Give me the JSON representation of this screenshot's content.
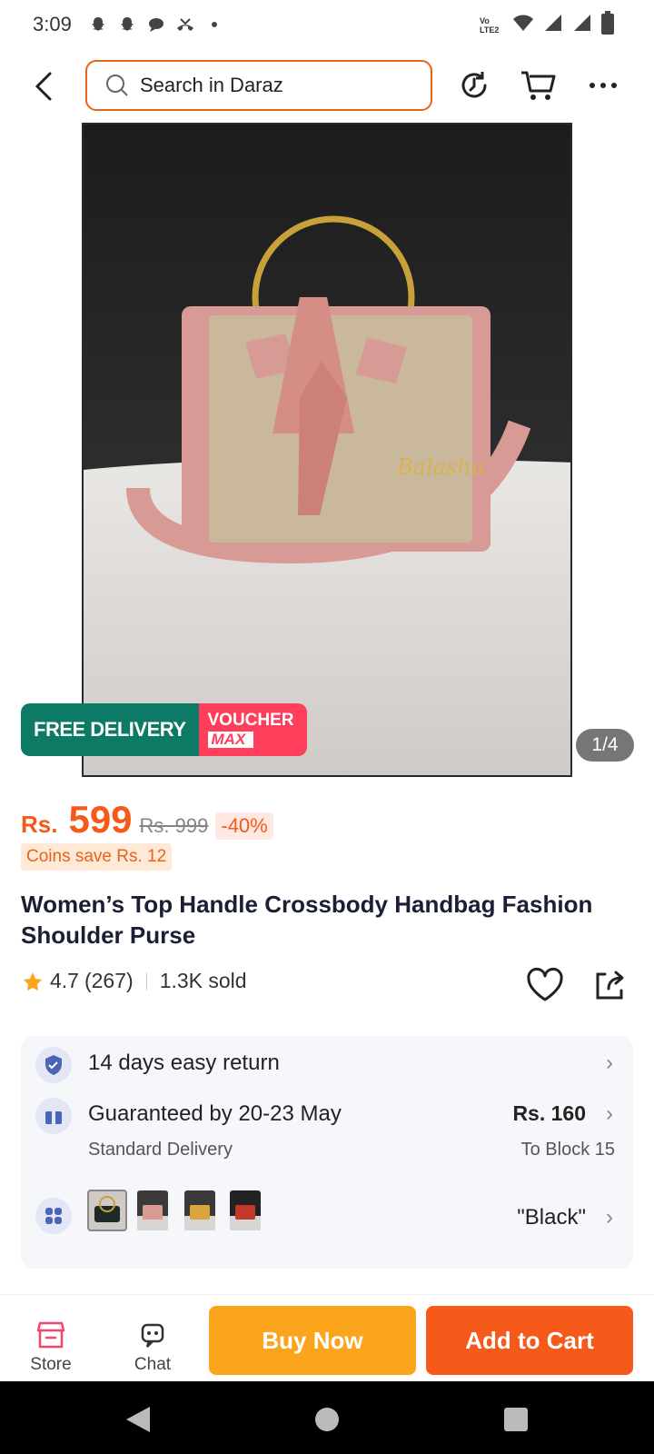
{
  "status_bar": {
    "time": "3:09",
    "network": "Vo LTE2"
  },
  "header": {
    "search_placeholder": "Search in Daraz"
  },
  "image": {
    "pager": "1/4",
    "promo_free": "FREE DELIVERY",
    "promo_voucher": "VOUCHER",
    "promo_voucher_sub": "MAX"
  },
  "price": {
    "currency": "Rs.",
    "value": "599",
    "original": "Rs. 999",
    "discount": "-40%",
    "coins": "Coins save Rs. 12"
  },
  "product": {
    "title": "Women’s Top Handle Crossbody Handbag Fashion Shoulder Purse",
    "rating": "4.7",
    "reviews": "(267)",
    "sold": "1.3K sold"
  },
  "info": {
    "return": "14 days easy return",
    "delivery": "Guaranteed by 20-23 May",
    "delivery_type": "Standard Delivery",
    "delivery_price": "Rs. 160",
    "delivery_to": "To Block 15",
    "variant": "\"Black\""
  },
  "bottom": {
    "store": "Store",
    "chat": "Chat",
    "buy_now": "Buy Now",
    "add_to_cart": "Add to Cart"
  },
  "colors": {
    "accent": "#f55a1a",
    "buy": "#faa51b",
    "free_delivery": "#0c7a64",
    "voucher": "#ff3e5c"
  }
}
